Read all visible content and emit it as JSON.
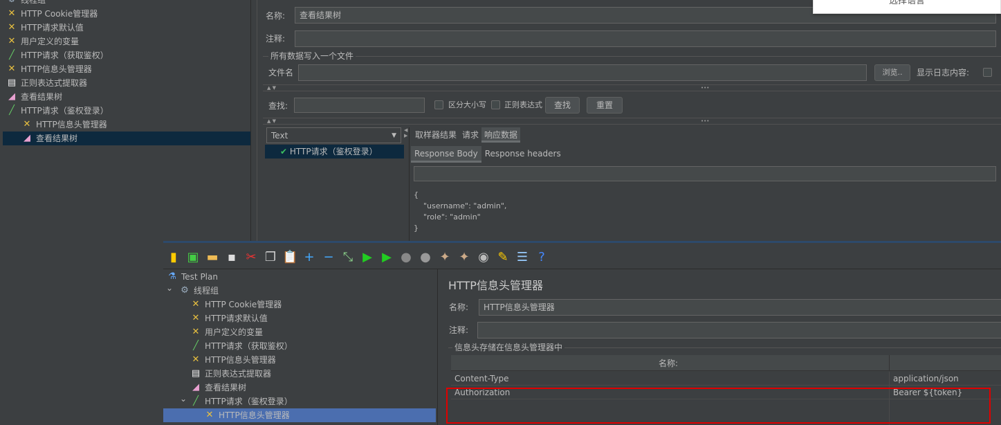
{
  "popup": {
    "label": "选择语言"
  },
  "back": {
    "tree": [
      {
        "label": "线程组",
        "icon": "gear-icon",
        "level": 0
      },
      {
        "label": "HTTP Cookie管理器",
        "icon": "wrench-icon",
        "level": 0
      },
      {
        "label": "HTTP请求默认值",
        "icon": "wrench-icon",
        "level": 0
      },
      {
        "label": "用户定义的变量",
        "icon": "wrench-icon",
        "level": 0
      },
      {
        "label": "HTTP请求（获取鉴权）",
        "icon": "pipette-icon",
        "level": 0
      },
      {
        "label": "HTTP信息头管理器",
        "icon": "wrench-icon",
        "level": 0
      },
      {
        "label": "正则表达式提取器",
        "icon": "extractor-icon",
        "level": 0
      },
      {
        "label": "查看结果树",
        "icon": "chart-icon",
        "level": 0
      },
      {
        "label": "HTTP请求（鉴权登录）",
        "icon": "pipette-icon",
        "level": 0
      },
      {
        "label": "HTTP信息头管理器",
        "icon": "wrench-icon",
        "level": 1
      },
      {
        "label": "查看结果树",
        "icon": "chart-icon",
        "level": 1,
        "selected": true
      }
    ],
    "name_label": "名称:",
    "name_value": "查看结果树",
    "comment_label": "注释:",
    "file_group": "所有数据写入一个文件",
    "file_label": "文件名",
    "browse": "浏览..",
    "show_log": "显示日志内容:",
    "find_label": "查找:",
    "case_label": "区分大小写",
    "regex_label": "正则表达式",
    "find_btn": "查找",
    "reset_btn": "重置",
    "split_dots": "•••",
    "split_arrows": "▲ ▼",
    "renderer": "Text",
    "result_item": "HTTP请求（鉴权登录）",
    "tabs": [
      "取样器结果",
      "请求",
      "响应数据"
    ],
    "subtabs": [
      "Response Body",
      "Response headers"
    ],
    "body": "{\n    \"username\": \"admin\",\n    \"role\": \"admin\"\n}"
  },
  "front": {
    "tree": [
      {
        "label": "Test Plan",
        "icon": "flask-icon"
      },
      {
        "label": "线程组",
        "icon": "gear-icon"
      },
      {
        "label": "HTTP Cookie管理器",
        "icon": "wrench-icon"
      },
      {
        "label": "HTTP请求默认值",
        "icon": "wrench-icon"
      },
      {
        "label": "用户定义的变量",
        "icon": "wrench-icon"
      },
      {
        "label": "HTTP请求（获取鉴权）",
        "icon": "pipette-icon"
      },
      {
        "label": "HTTP信息头管理器",
        "icon": "wrench-icon"
      },
      {
        "label": "正则表达式提取器",
        "icon": "extractor-icon"
      },
      {
        "label": "查看结果树",
        "icon": "chart-icon"
      },
      {
        "label": "HTTP请求（鉴权登录）",
        "icon": "pipette-icon"
      },
      {
        "label": "HTTP信息头管理器",
        "icon": "wrench-icon",
        "selected": true
      }
    ],
    "title": "HTTP信息头管理器",
    "name_label": "名称:",
    "name_value": "HTTP信息头管理器",
    "comment_label": "注释:",
    "group": "信息头存储在信息头管理器中",
    "col_name": "名称:",
    "headers": [
      {
        "name": "Content-Type",
        "value": "application/json"
      },
      {
        "name": "Authorization",
        "value": "Bearer ${token}"
      }
    ],
    "highlight_color": "#e00000"
  }
}
